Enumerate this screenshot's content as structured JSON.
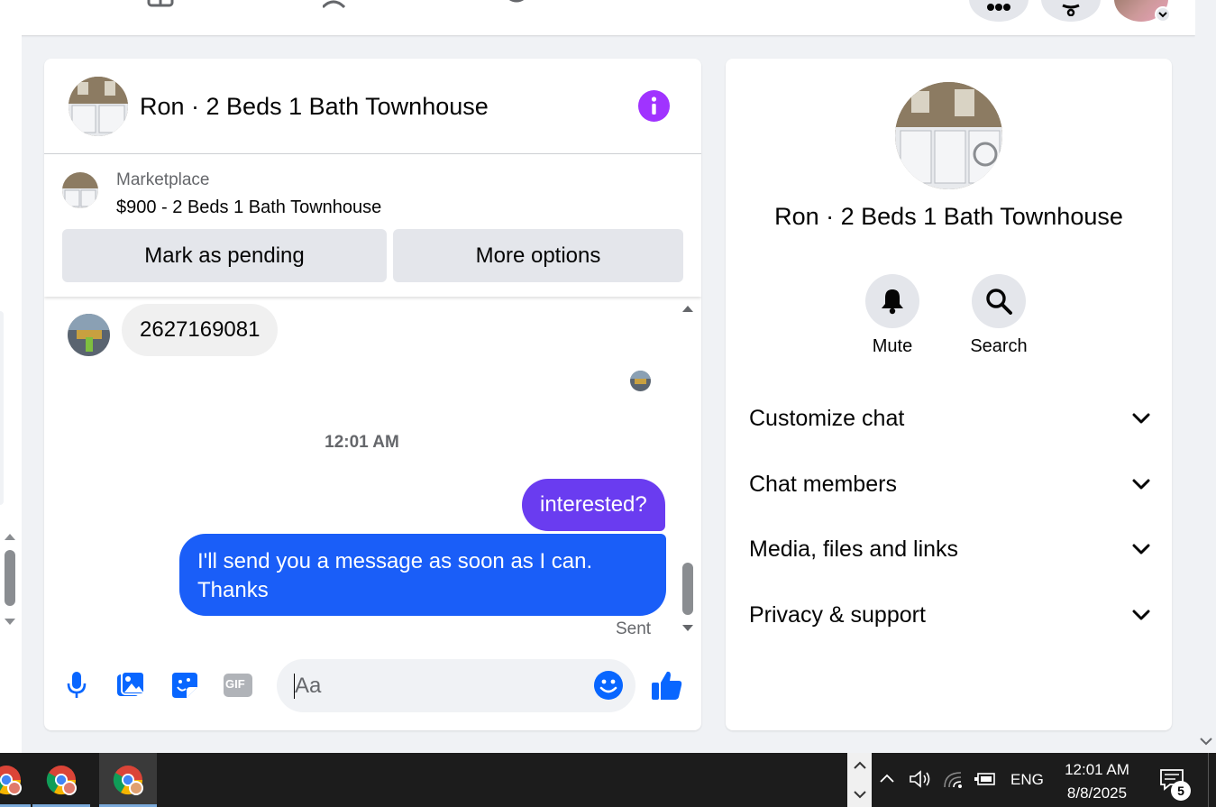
{
  "chat": {
    "title": "Ron · 2 Beds 1 Bath Townhouse",
    "marketplace_label": "Marketplace",
    "listing": "$900 - 2 Beds 1 Bath Townhouse",
    "mark_pending_label": "Mark as pending",
    "more_options_label": "More options",
    "messages": {
      "incoming_1": "2627169081",
      "timestamp": "12:01 AM",
      "outgoing_1": "interested?",
      "outgoing_2": "I'll send you a message as soon as I can. Thanks",
      "status": "Sent"
    },
    "composer": {
      "placeholder": "Aa",
      "gif_label": "GIF"
    }
  },
  "info_panel": {
    "title": "Ron · 2 Beds 1 Bath Townhouse",
    "actions": {
      "mute_label": "Mute",
      "search_label": "Search"
    },
    "sections": {
      "customize": "Customize chat",
      "members": "Chat members",
      "media": "Media, files and links",
      "privacy": "Privacy & support"
    }
  },
  "taskbar": {
    "language": "ENG",
    "time": "12:01 AM",
    "date": "8/8/2025",
    "notification_count": "5"
  },
  "colors": {
    "accent_purple": "#a033ff",
    "bubble_purple": "#6a3cf0",
    "bubble_blue": "#1a5ef8",
    "icon_blue": "#0866ff"
  }
}
